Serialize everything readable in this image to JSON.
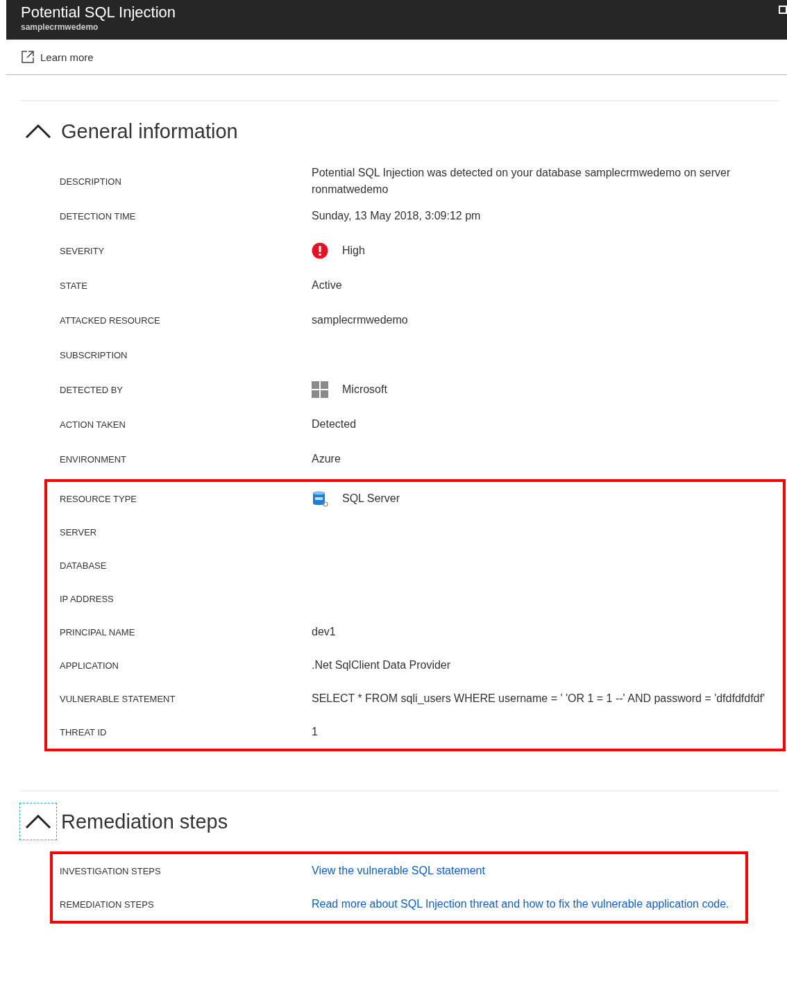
{
  "window": {
    "title": "Potential SQL Injection",
    "subtitle": "samplecrmwedemo"
  },
  "toolbar": {
    "learn_more": "Learn more"
  },
  "sections": [
    {
      "title": "General information",
      "expanded": true,
      "focused": false,
      "groups": [
        {
          "highlighted": false,
          "rows": [
            {
              "label": "DESCRIPTION",
              "kind": "text",
              "value": "Potential SQL Injection was detected on your database samplecrmwedemo on server ronmatwedemo"
            },
            {
              "label": "DETECTION TIME",
              "kind": "text",
              "value": "Sunday, 13 May 2018, 3:09:12 pm"
            },
            {
              "label": "SEVERITY",
              "kind": "severity",
              "value": "High"
            },
            {
              "label": "STATE",
              "kind": "text",
              "value": "Active"
            },
            {
              "label": "ATTACKED RESOURCE",
              "kind": "text",
              "value": "samplecrmwedemo"
            },
            {
              "label": "SUBSCRIPTION",
              "kind": "empty"
            },
            {
              "label": "DETECTED BY",
              "kind": "publisher",
              "value": "Microsoft"
            },
            {
              "label": "ACTION TAKEN",
              "kind": "text",
              "value": "Detected"
            },
            {
              "label": "ENVIRONMENT",
              "kind": "text",
              "value": "Azure"
            }
          ]
        },
        {
          "highlighted": true,
          "rows": [
            {
              "label": "RESOURCE TYPE",
              "kind": "sql",
              "value": "SQL Server"
            },
            {
              "label": "SERVER",
              "kind": "empty"
            },
            {
              "label": "DATABASE",
              "kind": "empty"
            },
            {
              "label": "IP ADDRESS",
              "kind": "empty"
            },
            {
              "label": "PRINCIPAL NAME",
              "kind": "text",
              "value": "dev1"
            },
            {
              "label": "APPLICATION",
              "kind": "text",
              "value": ".Net SqlClient Data Provider"
            },
            {
              "label": "VULNERABLE STATEMENT",
              "kind": "text",
              "value": "SELECT * FROM sqli_users WHERE username = ' 'OR 1 = 1 --' AND password = 'dfdfdfdfdf'"
            },
            {
              "label": "THREAT ID",
              "kind": "text",
              "value": "1"
            }
          ]
        }
      ]
    },
    {
      "title": "Remediation steps",
      "expanded": true,
      "focused": true,
      "groups": [
        {
          "highlighted": true,
          "rows": [
            {
              "label": "INVESTIGATION STEPS",
              "kind": "link",
              "value": "View the vulnerable SQL statement"
            },
            {
              "label": "REMEDIATION STEPS",
              "kind": "link",
              "value": "Read more about SQL Injection threat and how to fix the vulnerable application code."
            }
          ]
        }
      ]
    }
  ]
}
